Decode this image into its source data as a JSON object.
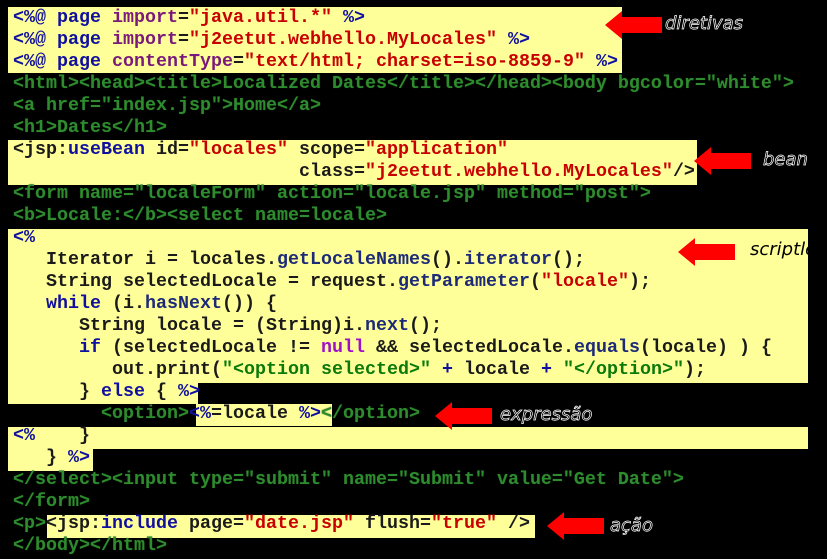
{
  "colors": {
    "highlight": "#ffff99",
    "arrow": "#ff0000",
    "background": "#000000",
    "html_text": "#2e8b2e"
  },
  "code": {
    "lines": [
      [
        [
          "k",
          "<%@ page "
        ],
        [
          "a",
          "import"
        ],
        [
          "p",
          "="
        ],
        [
          "s",
          "\"java.util.*\""
        ],
        [
          "p",
          " "
        ],
        [
          "k",
          "%>"
        ]
      ],
      [
        [
          "k",
          "<%@ page "
        ],
        [
          "a",
          "import"
        ],
        [
          "p",
          "="
        ],
        [
          "s",
          "\"j2eetut.webhello.MyLocales\""
        ],
        [
          "p",
          " "
        ],
        [
          "k",
          "%>"
        ]
      ],
      [
        [
          "k",
          "<%@ page "
        ],
        [
          "a",
          "contentType"
        ],
        [
          "p",
          "="
        ],
        [
          "s",
          "\"text/html; charset=iso-8859-9\""
        ],
        [
          "p",
          " "
        ],
        [
          "k",
          "%>"
        ]
      ],
      [
        [
          "h",
          "<html><head><title>Localized Dates</title></head><body bgcolor=\"white\">"
        ]
      ],
      [
        [
          "h",
          "<a href=\"index.jsp\">Home</a>"
        ]
      ],
      [
        [
          "h",
          "<h1>Dates</h1>"
        ]
      ],
      [
        [
          "p",
          "<jsp:"
        ],
        [
          "k",
          "useBean"
        ],
        [
          "p",
          " id="
        ],
        [
          "s",
          "\"locales\""
        ],
        [
          "p",
          " scope="
        ],
        [
          "s",
          "\"application\""
        ]
      ],
      [
        [
          "p",
          "                          class="
        ],
        [
          "s",
          "\"j2eetut.webhello.MyLocales\""
        ],
        [
          "p",
          "/>"
        ]
      ],
      [
        [
          "h",
          "<form name=\"localeForm\" action=\"locale.jsp\" method=\"post\">"
        ]
      ],
      [
        [
          "h",
          "<b>Locale:</b><select name=locale>"
        ]
      ],
      [
        [
          "k",
          "<%"
        ]
      ],
      [
        [
          "p",
          "   Iterator i = locales."
        ],
        [
          "m",
          "getLocaleNames"
        ],
        [
          "p",
          "()."
        ],
        [
          "m",
          "iterator"
        ],
        [
          "p",
          "();"
        ]
      ],
      [
        [
          "p",
          "   String selectedLocale = request."
        ],
        [
          "m",
          "getParameter"
        ],
        [
          "p",
          "("
        ],
        [
          "s",
          "\"locale\""
        ],
        [
          "p",
          ");"
        ]
      ],
      [
        [
          "p",
          "   "
        ],
        [
          "k",
          "while"
        ],
        [
          "p",
          " (i."
        ],
        [
          "m",
          "hasNext"
        ],
        [
          "p",
          "()) {"
        ]
      ],
      [
        [
          "p",
          "      String locale = (String)i."
        ],
        [
          "m",
          "next"
        ],
        [
          "p",
          "();"
        ]
      ],
      [
        [
          "p",
          "      "
        ],
        [
          "k",
          "if"
        ],
        [
          "p",
          " (selectedLocale != "
        ],
        [
          "n",
          "null"
        ],
        [
          "p",
          " && selectedLocale."
        ],
        [
          "m",
          "equals"
        ],
        [
          "p",
          "(locale) ) {"
        ]
      ],
      [
        [
          "p",
          "         out.print("
        ],
        [
          "g",
          "\"<option selected>\""
        ],
        [
          "k",
          " + "
        ],
        [
          "p",
          "locale"
        ],
        [
          "k",
          " + "
        ],
        [
          "g",
          "\"</option>\""
        ],
        [
          "p",
          ");"
        ]
      ],
      [
        [
          "p",
          "      } "
        ],
        [
          "k",
          "else"
        ],
        [
          "p",
          " { "
        ],
        [
          "k",
          "%>"
        ]
      ],
      [
        [
          "h",
          "        <option>"
        ],
        [
          "k",
          "<%"
        ],
        [
          "p",
          "=locale "
        ],
        [
          "k",
          "%>"
        ],
        [
          "h",
          "</option>"
        ]
      ],
      [
        [
          "k",
          "<%"
        ],
        [
          "p",
          "    }"
        ]
      ],
      [
        [
          "p",
          "   } "
        ],
        [
          "k",
          "%>"
        ]
      ],
      [
        [
          "h",
          "</select><input type=\"submit\" name=\"Submit\" value=\"Get Date\">"
        ]
      ],
      [
        [
          "h",
          "</form>"
        ]
      ],
      [
        [
          "h",
          "<p>"
        ],
        [
          "p",
          "<jsp:"
        ],
        [
          "k",
          "include"
        ],
        [
          "p",
          " page="
        ],
        [
          "s",
          "\"date.jsp\""
        ],
        [
          "p",
          " flush="
        ],
        [
          "s",
          "\"true\""
        ],
        [
          "p",
          " />"
        ]
      ],
      [
        [
          "h",
          "</body></html>"
        ]
      ]
    ]
  },
  "annotations": {
    "directives": "diretivas",
    "bean": "bean",
    "scriptlet": "scriptlet",
    "expression": "expressão",
    "action": "ação"
  }
}
